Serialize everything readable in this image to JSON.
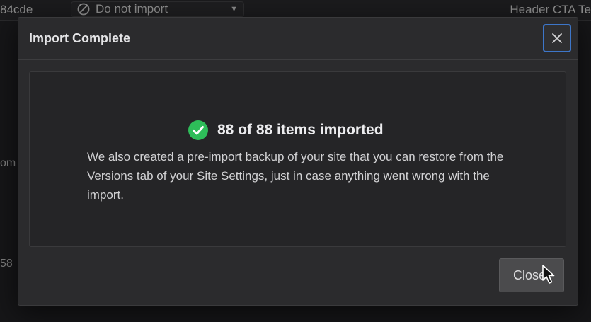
{
  "background": {
    "id_fragment": "84cde",
    "select_value": "Do not import",
    "right_text": "Header CTA Te",
    "edge_text_1": "om",
    "edge_text_2": "58"
  },
  "modal": {
    "title": "Import Complete",
    "result": "88 of 88 items imported",
    "description": "We also created a pre-import backup of your site that you can restore from the Versions tab of your Site Settings, just in case anything went wrong with the import.",
    "close_button_label": "Close",
    "icons": {
      "success": "check-circle-icon",
      "dismiss": "close-icon",
      "pointer": "mouse-cursor-icon"
    }
  },
  "colors": {
    "success_green": "#2ebd59",
    "focus_blue": "#3d76c9",
    "modal_bg": "#2b2b2d"
  }
}
